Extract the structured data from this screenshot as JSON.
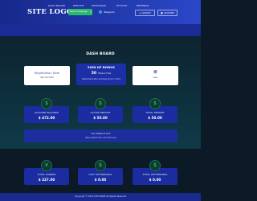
{
  "header": {
    "logo": "SITE LOGO",
    "language_select": "Select Language",
    "telegram": "Telegram",
    "login_label": "LOGOUT",
    "account_label": "ACCOUNT"
  },
  "nav": {
    "items": [
      "DASH BOARD",
      "DEPOSIT",
      "WITHDRAW",
      "HISTORY",
      "REFERRAL"
    ]
  },
  "dashboard": {
    "title": "DASH BOARD",
    "registration": {
      "label": "Registration Date",
      "value": "Sep-09-2019"
    },
    "signup_bonus": {
      "title": "SIGN UP BONUS",
      "amount": "50",
      "unit": "Tokens Free",
      "note": "Redeemable after exchange launch in 2021"
    },
    "user": {
      "name": "user"
    },
    "stats_top": [
      {
        "label": "ACCOUNT BALANCE",
        "value": "$ 472.00"
      },
      {
        "label": "ACTIVE DEPOSIT",
        "value": "$ 50.00"
      },
      {
        "label": "TOTAL DEPOSIT",
        "value": "$ 50.00"
      }
    ],
    "referral": {
      "label": "Your Referral Link",
      "link": "https://sitedomain.com/?ref=user"
    },
    "stats_bottom": [
      {
        "label": "TOTAL EARNED",
        "value": "$ 327.00"
      },
      {
        "label": "LAST WITHDRAWAL",
        "value": "$ 0.00"
      },
      {
        "label": "TOTAL WITHDRAWAL",
        "value": "$ 0.00"
      }
    ]
  },
  "footer": {
    "text": "Copyright © 2019 SITE NAME All Rights Reserved"
  },
  "colors": {
    "background": "#0b1a26",
    "header": "#1f36b0",
    "card": "#1a2c9f",
    "accent_green": "#2ee08a"
  }
}
